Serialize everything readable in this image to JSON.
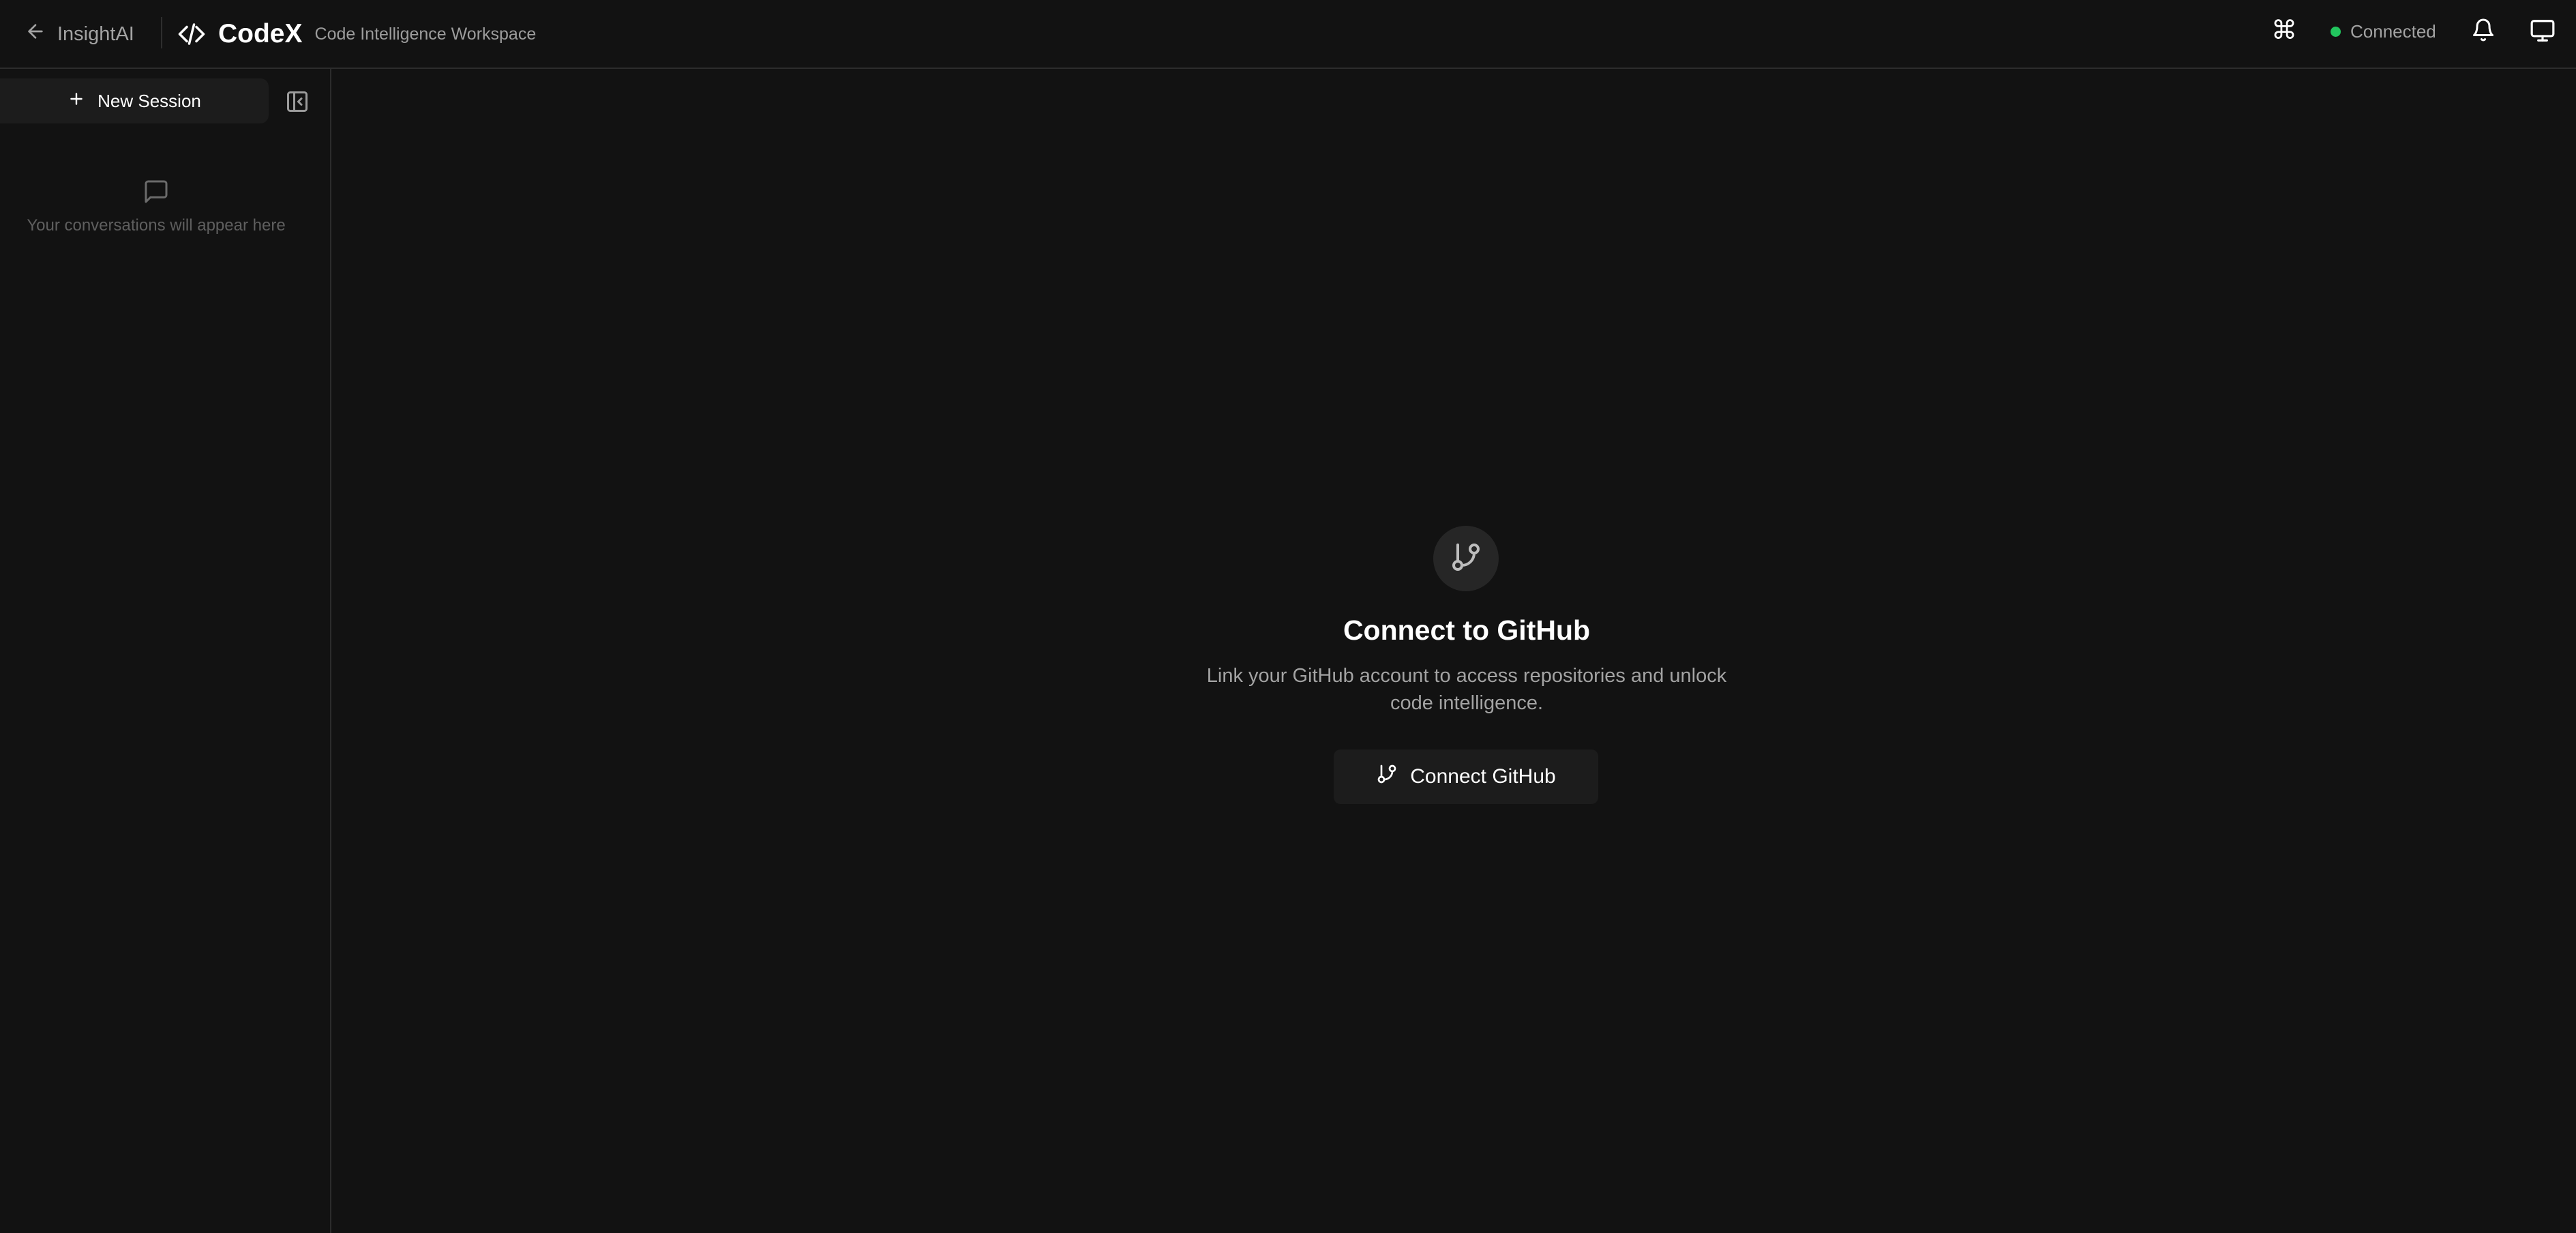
{
  "header": {
    "back_label": "InsightAI",
    "brand_title": "CodeX",
    "brand_subtitle": "Code Intelligence Workspace",
    "command_glyph": "⌘",
    "status_label": "Connected",
    "status_color": "#22c55e",
    "icons": [
      "arrow-left-icon",
      "code-icon",
      "command-icon",
      "bell-icon",
      "monitor-icon"
    ]
  },
  "sidebar": {
    "new_session_label": "New Session",
    "empty_text": "Your conversations will appear here",
    "icons": [
      "plus-icon",
      "sidebar-collapse-icon",
      "chat-bubble-icon"
    ]
  },
  "main": {
    "title": "Connect to GitHub",
    "description": "Link your GitHub account to access repositories and unlock code intelligence.",
    "button_label": "Connect GitHub",
    "icons": [
      "git-branch-icon"
    ]
  },
  "colors": {
    "background": "#121212",
    "surface": "#1c1c1c",
    "border": "#2c2c2c",
    "muted_text": "#a3a3a3",
    "faint_text": "#5f5f5f"
  }
}
